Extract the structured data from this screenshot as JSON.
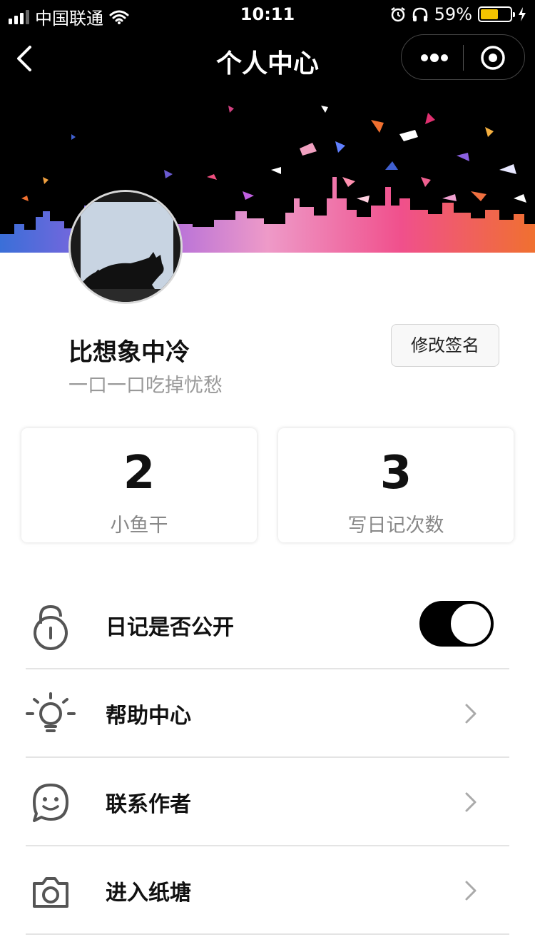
{
  "status_bar": {
    "carrier": "中国联通",
    "time": "10:11",
    "battery_percent": "59%",
    "battery_level": 0.59,
    "icons": [
      "signal-icon",
      "wifi-icon",
      "alarm-icon",
      "headphones-icon",
      "battery-icon",
      "charging-icon"
    ]
  },
  "nav": {
    "title": "个人中心",
    "back_icon": "back-arrow-icon",
    "more_icon": "more-dots-icon",
    "close_icon": "target-close-icon"
  },
  "profile": {
    "username": "比想象中冷",
    "signature": "一口一口吃掉忧愁",
    "edit_button": "修改签名"
  },
  "stats": [
    {
      "value": "2",
      "label": "小鱼干"
    },
    {
      "value": "3",
      "label": "写日记次数"
    }
  ],
  "menu": [
    {
      "label": "日记是否公开",
      "icon": "lock-icon",
      "type": "toggle",
      "on": true
    },
    {
      "label": "帮助中心",
      "icon": "lightbulb-icon",
      "type": "link"
    },
    {
      "label": "联系作者",
      "icon": "smiley-chat-icon",
      "type": "link"
    },
    {
      "label": "进入纸塘",
      "icon": "camera-icon",
      "type": "link"
    }
  ],
  "colors": {
    "toggle_on": "#000000",
    "battery": "#f5c400"
  }
}
